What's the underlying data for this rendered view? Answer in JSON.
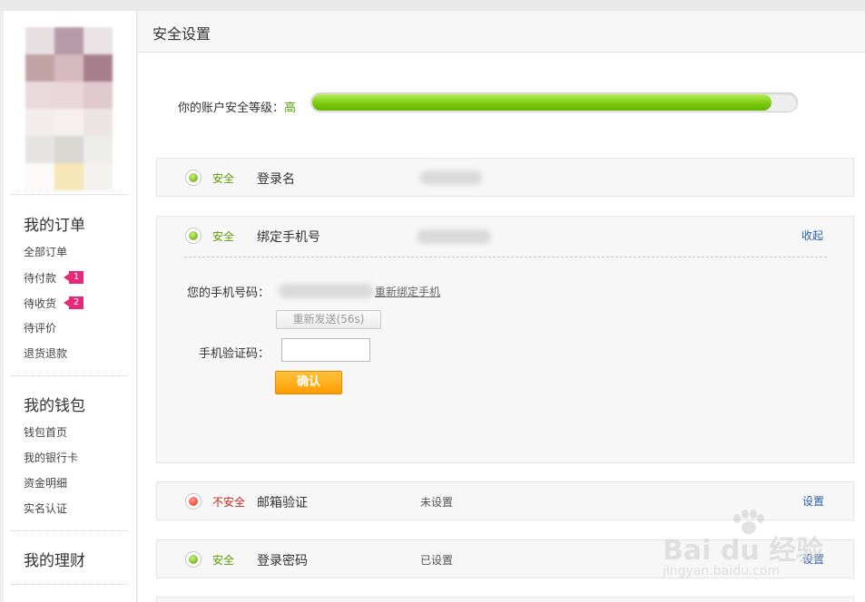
{
  "page": {
    "title": "安全设置"
  },
  "sidebar": {
    "sections": [
      {
        "heading": "我的订单",
        "links": [
          "全部订单",
          "待付款",
          "待收货",
          "待评价",
          "退货退款"
        ],
        "badges": {
          "1": "1",
          "2": "2"
        }
      },
      {
        "heading": "我的钱包",
        "links": [
          "钱包首页",
          "我的银行卡",
          "资金明细",
          "实名认证"
        ]
      },
      {
        "heading": "我的理财"
      }
    ]
  },
  "security_level": {
    "label": "你的账户安全等级：",
    "value": "高",
    "percent": 95
  },
  "rows": {
    "login_name": {
      "status": "安全",
      "title": "登录名"
    },
    "phone": {
      "status": "安全",
      "title": "绑定手机号",
      "action": "收起",
      "form": {
        "phone_label": "您的手机号码：",
        "rebind": "重新绑定手机",
        "resend": "重新发送(56s)",
        "code_label": "手机验证码：",
        "confirm": "确认"
      }
    },
    "email": {
      "status": "不安全",
      "title": "邮箱验证",
      "value": "未设置",
      "action": "设置"
    },
    "password": {
      "status": "安全",
      "title": "登录密码",
      "value": "已设置",
      "action": "设置"
    }
  },
  "watermark": {
    "main": "Bai du 经验",
    "sub": "jingyan.baidu.com"
  },
  "colors": {
    "safe": "#5a9e00",
    "unsafe": "#c8261a",
    "link": "#2a5ea8",
    "confirm": "#ff9c00",
    "badge": "#e6297a"
  }
}
